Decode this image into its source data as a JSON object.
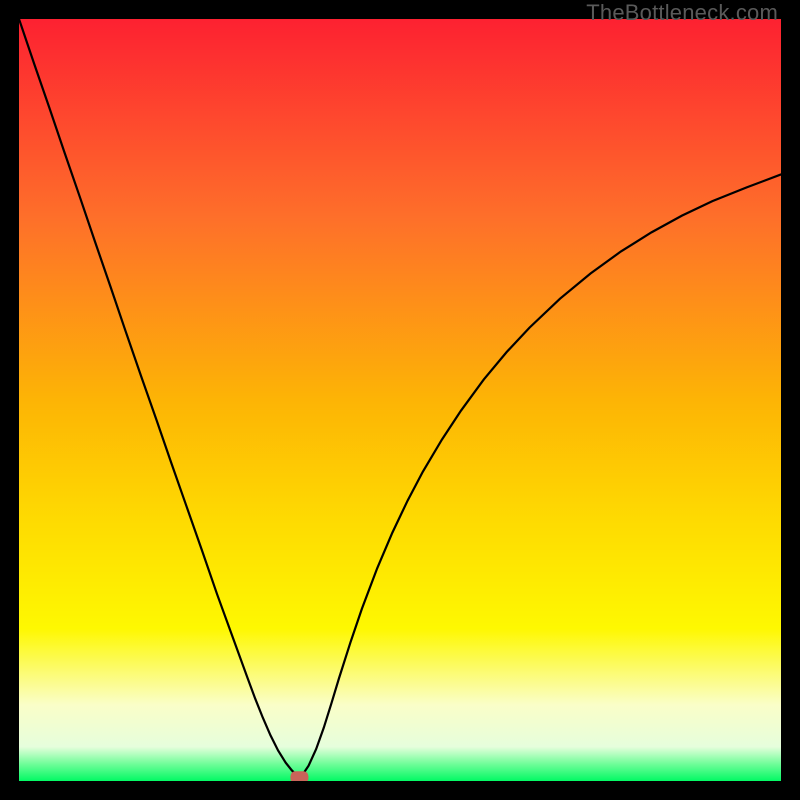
{
  "watermark": "TheBottleneck.com",
  "chart_data": {
    "type": "line",
    "title": "",
    "xlabel": "",
    "ylabel": "",
    "xlim": [
      0,
      1
    ],
    "ylim": [
      0,
      1
    ],
    "grid": false,
    "legend": false,
    "background_gradient": {
      "top_color": "#fd2131",
      "middle_color": "#fedb01",
      "near_bottom_color": "#fafec8",
      "bottom_edge_color": "#02f964",
      "stops": [
        {
          "offset": 0.0,
          "color": "#fd2131"
        },
        {
          "offset": 0.26,
          "color": "#fe6f2a"
        },
        {
          "offset": 0.5,
          "color": "#fdb405"
        },
        {
          "offset": 0.66,
          "color": "#fedb01"
        },
        {
          "offset": 0.8,
          "color": "#fef801"
        },
        {
          "offset": 0.9,
          "color": "#fafec8"
        },
        {
          "offset": 0.955,
          "color": "#e6fedc"
        },
        {
          "offset": 0.978,
          "color": "#6efd98"
        },
        {
          "offset": 1.0,
          "color": "#02f964"
        }
      ]
    },
    "minimum_marker": {
      "x": 0.368,
      "y": 0.995,
      "color": "#c96459"
    },
    "series": [
      {
        "name": "bottleneck-curve",
        "color": "#000000",
        "width": 2.2,
        "x": [
          0.0,
          0.02,
          0.04,
          0.06,
          0.08,
          0.1,
          0.12,
          0.14,
          0.16,
          0.18,
          0.2,
          0.22,
          0.24,
          0.26,
          0.28,
          0.3,
          0.31,
          0.32,
          0.33,
          0.34,
          0.35,
          0.358,
          0.364,
          0.368,
          0.372,
          0.38,
          0.39,
          0.4,
          0.41,
          0.42,
          0.435,
          0.45,
          0.47,
          0.49,
          0.51,
          0.53,
          0.555,
          0.58,
          0.61,
          0.64,
          0.67,
          0.71,
          0.75,
          0.79,
          0.83,
          0.87,
          0.91,
          0.955,
          1.0
        ],
        "y": [
          0.0,
          0.059,
          0.117,
          0.176,
          0.234,
          0.293,
          0.351,
          0.41,
          0.468,
          0.525,
          0.583,
          0.64,
          0.697,
          0.755,
          0.81,
          0.865,
          0.892,
          0.917,
          0.94,
          0.96,
          0.976,
          0.986,
          0.992,
          0.995,
          0.992,
          0.98,
          0.958,
          0.93,
          0.898,
          0.865,
          0.818,
          0.774,
          0.721,
          0.674,
          0.632,
          0.594,
          0.552,
          0.514,
          0.473,
          0.437,
          0.405,
          0.367,
          0.334,
          0.305,
          0.28,
          0.258,
          0.239,
          0.221,
          0.204
        ]
      }
    ]
  }
}
